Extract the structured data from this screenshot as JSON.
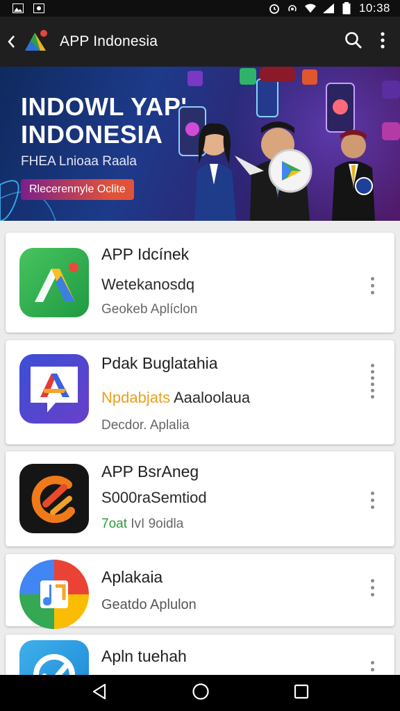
{
  "status_bar": {
    "time": "10:38"
  },
  "app_bar": {
    "title": "APP Indonesia"
  },
  "banner": {
    "headline_line1": "INDOWL YAP'",
    "headline_line2": "INDONESIA",
    "subtitle": "FHEA Lnioaa Raala",
    "cta": "Rlecerennyle Oclite"
  },
  "apps": [
    {
      "title": "APP Idcínek",
      "line2": "Wetekanosdq",
      "line3": "Geokeb Aplíclon"
    },
    {
      "title": "Pdak Buglatahia",
      "line2_highlight": "Npdabjats",
      "line2_rest": " Aaaloolaua",
      "line3": "Decdor. Aplalia"
    },
    {
      "title": "APP BsrAneg",
      "line2": "S000raSemtiod",
      "line3_highlight": "7oat",
      "line3_rest": " IvI 9oidla"
    },
    {
      "title": "Aplakaia",
      "line2": "Geatdo  Aplulon"
    },
    {
      "title": "Apln tuehah"
    }
  ],
  "colors": {
    "status_bar_bg": "#0f0f0f",
    "app_bar_bg": "#1f1f1f",
    "list_bg": "#ececec",
    "highlight_orange": "#e8a21a",
    "highlight_green": "#2e9a3a"
  }
}
